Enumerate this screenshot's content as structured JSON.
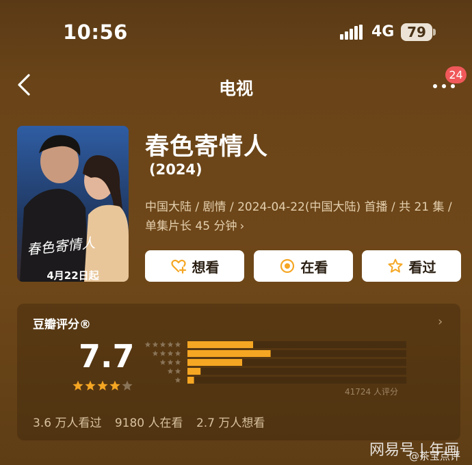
{
  "status_bar": {
    "time": "10:56",
    "network": "4G",
    "battery": "79"
  },
  "nav": {
    "title": "电视",
    "notification_badge": "24"
  },
  "poster": {
    "date_text": "4月22日起",
    "title_art": "春色寄情人"
  },
  "show": {
    "title": "春色寄情人",
    "year": "(2024)",
    "meta_line1": "中国大陆 / 剧情 / 2024-04-22(中国大陆) 首播 / 共 21 集 /",
    "meta_line2": "单集片长 45 分钟"
  },
  "buttons": {
    "want": "想看",
    "watching": "在看",
    "watched": "看过"
  },
  "rating": {
    "label": "豆瓣评分®",
    "score": "7.7",
    "stars_filled": 4,
    "stars_total": 5,
    "distribution_fractions": [
      0.3,
      0.38,
      0.25,
      0.06,
      0.03
    ],
    "count_text": "41724 人评分",
    "accent_color": "#f5a623"
  },
  "stats": {
    "seen": "3.6 万人看过",
    "watching": "9180 人在看",
    "want": "2.7 万人想看"
  },
  "watermark": {
    "line1": "网易号 | 年画",
    "line2": "@茶宝点评"
  }
}
